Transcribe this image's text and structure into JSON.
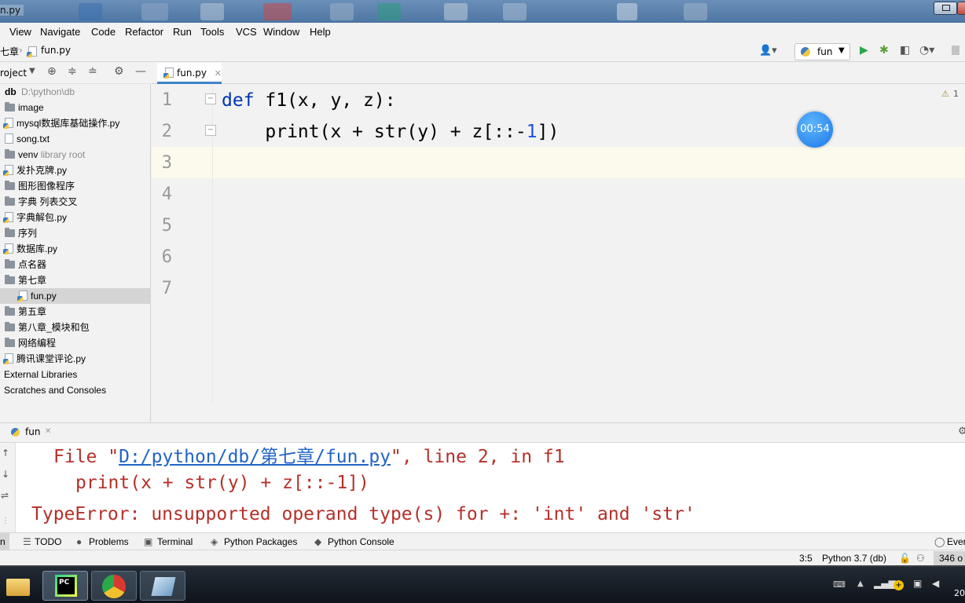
{
  "window": {
    "title": "n.py"
  },
  "menu": {
    "items": [
      "View",
      "Navigate",
      "Code",
      "Refactor",
      "Run",
      "Tools",
      "VCS",
      "Window",
      "Help"
    ]
  },
  "breadcrumb": {
    "parent": "七章",
    "file": "fun.py"
  },
  "run_config": {
    "label": "fun"
  },
  "project": {
    "header_label": "roject",
    "root_name": "db",
    "root_path": "D:\\python\\db",
    "items": [
      {
        "label": "image",
        "type": "folder"
      },
      {
        "label": "mysql数据库基础操作.py",
        "type": "py"
      },
      {
        "label": "song.txt",
        "type": "txt"
      },
      {
        "label": "venv",
        "type": "folder",
        "note": "library root"
      },
      {
        "label": "发扑克牌.py",
        "type": "py"
      },
      {
        "label": "图形图像程序",
        "type": "folder"
      },
      {
        "label": "字典 列表交叉",
        "type": "folder"
      },
      {
        "label": "字典解包.py",
        "type": "py"
      },
      {
        "label": "序列",
        "type": "folder"
      },
      {
        "label": "数据库.py",
        "type": "py"
      },
      {
        "label": "点名器",
        "type": "folder"
      },
      {
        "label": "第七章",
        "type": "folder"
      },
      {
        "label": "fun.py",
        "type": "py"
      },
      {
        "label": "第五章",
        "type": "folder"
      },
      {
        "label": "第八章_模块和包",
        "type": "folder"
      },
      {
        "label": "网络编程",
        "type": "folder"
      },
      {
        "label": "腾讯课堂评论.py",
        "type": "py"
      }
    ],
    "external": "External Libraries",
    "scratches": "Scratches and Consoles"
  },
  "editor": {
    "tab_label": "fun.py",
    "line_numbers": [
      "1",
      "2",
      "3",
      "4",
      "5",
      "6",
      "7"
    ],
    "warning_count": "1",
    "line1": {
      "kw": "def",
      "rest": " f1(x, y, z):"
    },
    "line2": {
      "pre": "    print(x + str(y) + z[::-",
      "num": "1",
      "post": "])"
    }
  },
  "timer": {
    "label": "00:54"
  },
  "run": {
    "tab_label": "fun",
    "line1_pre": "File \"",
    "line1_link": "D:/python/db/第七章/fun.py",
    "line1_post": "\", line 2, in f1",
    "line2": "print(x + str(y) + z[::-1])",
    "line3": "TypeError: unsupported operand type(s) for +: 'int' and 'str'"
  },
  "toolwindows": {
    "n": "n",
    "todo": "TODO",
    "problems": "Problems",
    "terminal": "Terminal",
    "packages": "Python Packages",
    "console": "Python Console",
    "event": "Ever"
  },
  "status": {
    "position": "3:5",
    "interpreter": "Python 3.7 (db)",
    "memory": "346 o"
  },
  "taskbar": {
    "clock": "20"
  },
  "colors": {
    "keyword": "#0033b3",
    "number": "#1750eb",
    "error": "#b5302a",
    "link": "#2264c8",
    "accent": "#4083c9"
  }
}
